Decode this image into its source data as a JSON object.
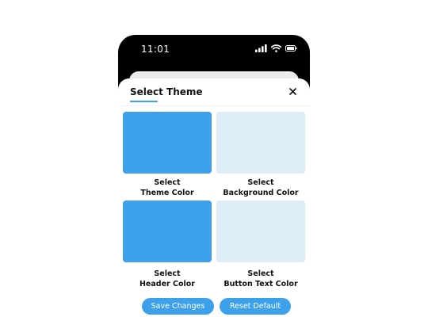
{
  "status_bar": {
    "time": "11:01"
  },
  "sheet": {
    "title": "Select Theme",
    "options": [
      {
        "line1": "Select",
        "line2": "Theme Color",
        "color": "#3da0ea"
      },
      {
        "line1": "Select",
        "line2": "Background Color",
        "color": "#ddeef9"
      },
      {
        "line1": "Select",
        "line2": "Header Color",
        "color": "#3da0ea"
      },
      {
        "line1": "Select",
        "line2": "Button Text Color",
        "color": "#ddeef9"
      }
    ],
    "buttons": {
      "save_label": "Save Changes",
      "reset_label": "Reset Default"
    }
  },
  "colors": {
    "accent": "#3da0ea",
    "light": "#ddeef9",
    "phone_frame": "#000000"
  },
  "icons": {
    "signal": "cellular-signal-icon",
    "wifi": "wifi-icon",
    "battery": "battery-icon",
    "close": "close-icon"
  }
}
